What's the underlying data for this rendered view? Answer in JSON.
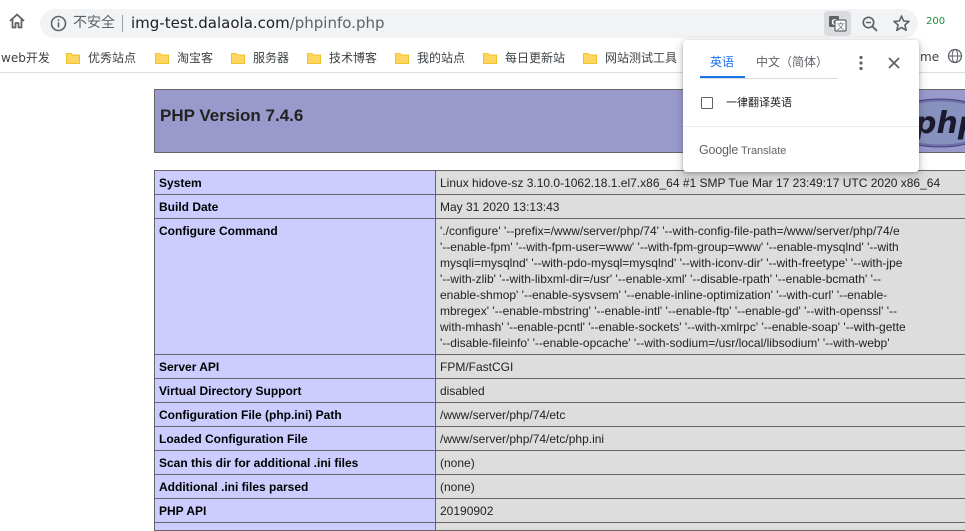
{
  "browser": {
    "security_status": "不安全",
    "url_host": "img-test.dalaola.com",
    "url_path": "/phpinfo.php",
    "extension_badge": "200"
  },
  "bookmarks": [
    {
      "label": "web开发",
      "folder": false
    },
    {
      "label": "优秀站点",
      "folder": true
    },
    {
      "label": "淘宝客",
      "folder": true
    },
    {
      "label": "服务器",
      "folder": true
    },
    {
      "label": "技术博客",
      "folder": true
    },
    {
      "label": "我的站点",
      "folder": true
    },
    {
      "label": "每日更新站",
      "folder": true
    },
    {
      "label": "网站测试工具",
      "folder": true
    },
    {
      "label": "me",
      "folder": false
    }
  ],
  "page": {
    "title": "PHP Version 7.4.6",
    "logo_text": "php",
    "rows": [
      {
        "key": "System",
        "value": "Linux hidove-sz 3.10.0-1062.18.1.el7.x86_64 #1 SMP Tue Mar 17 23:49:17 UTC 2020 x86_64"
      },
      {
        "key": "Build Date",
        "value": "May 31 2020 13:13:43"
      },
      {
        "key": "Configure Command",
        "value": "'./configure' '--prefix=/www/server/php/74' '--with-config-file-path=/www/server/php/74/e\n'--enable-fpm' '--with-fpm-user=www' '--with-fpm-group=www' '--enable-mysqlnd' '--with\nmysqli=mysqlnd' '--with-pdo-mysql=mysqlnd' '--with-iconv-dir' '--with-freetype' '--with-jpe\n'--with-zlib' '--with-libxml-dir=/usr' '--enable-xml' '--disable-rpath' '--enable-bcmath' '--\nenable-shmop' '--enable-sysvsem' '--enable-inline-optimization' '--with-curl' '--enable-\nmbregex' '--enable-mbstring' '--enable-intl' '--enable-ftp' '--enable-gd' '--with-openssl' '--\nwith-mhash' '--enable-pcntl' '--enable-sockets' '--with-xmlrpc' '--enable-soap' '--with-gette\n'--disable-fileinfo' '--enable-opcache' '--with-sodium=/usr/local/libsodium' '--with-webp'"
      },
      {
        "key": "Server API",
        "value": "FPM/FastCGI"
      },
      {
        "key": "Virtual Directory Support",
        "value": "disabled"
      },
      {
        "key": "Configuration File (php.ini) Path",
        "value": "/www/server/php/74/etc"
      },
      {
        "key": "Loaded Configuration File",
        "value": "/www/server/php/74/etc/php.ini"
      },
      {
        "key": "Scan this dir for additional .ini files",
        "value": "(none)"
      },
      {
        "key": "Additional .ini files parsed",
        "value": "(none)"
      },
      {
        "key": "PHP API",
        "value": "20190902"
      },
      {
        "key": "",
        "value": ""
      }
    ]
  },
  "translate_popup": {
    "source_tab": "英语",
    "target_tab": "中文（简体）",
    "always_translate_label": "一律翻译英语",
    "always_translate_checked": false,
    "brand_google": "Google",
    "brand_translate": "Translate"
  },
  "colors": {
    "php_header_bg": "#9999cc",
    "php_key_bg": "#ccccff",
    "php_value_bg": "#dddddd",
    "translate_accent": "#1a73e8",
    "folder_yellow": "#fcd663"
  }
}
